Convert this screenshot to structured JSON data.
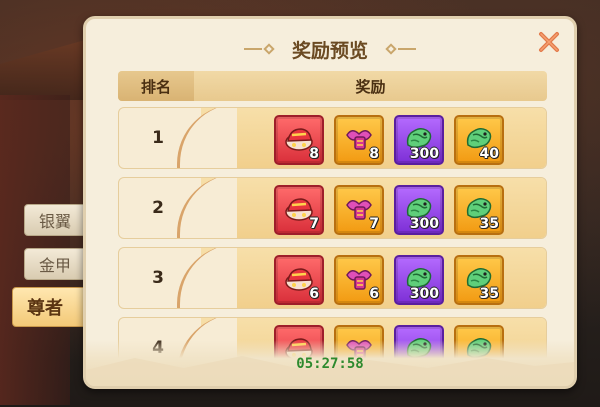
{
  "panel": {
    "title": "奖励预览",
    "header": {
      "rank_label": "排名",
      "reward_label": "奖励"
    },
    "timer": "05:27:58"
  },
  "side_tabs": [
    {
      "label": "银翼",
      "active": false
    },
    {
      "label": "金甲",
      "active": false
    },
    {
      "label": "尊者",
      "active": true
    }
  ],
  "rows": [
    {
      "rank": "1",
      "rewards": [
        {
          "icon": "red-helmet-icon",
          "rarity": "red",
          "qty": "8"
        },
        {
          "icon": "pink-ribbon-icon",
          "rarity": "orange",
          "qty": "8"
        },
        {
          "icon": "jade-dragon-icon",
          "rarity": "purple",
          "qty": "300"
        },
        {
          "icon": "jade-dragon-icon",
          "rarity": "orange",
          "qty": "40"
        }
      ]
    },
    {
      "rank": "2",
      "rewards": [
        {
          "icon": "red-helmet-icon",
          "rarity": "red",
          "qty": "7"
        },
        {
          "icon": "pink-ribbon-icon",
          "rarity": "orange",
          "qty": "7"
        },
        {
          "icon": "jade-dragon-icon",
          "rarity": "purple",
          "qty": "300"
        },
        {
          "icon": "jade-dragon-icon",
          "rarity": "orange",
          "qty": "35"
        }
      ]
    },
    {
      "rank": "3",
      "rewards": [
        {
          "icon": "red-helmet-icon",
          "rarity": "red",
          "qty": "6"
        },
        {
          "icon": "pink-ribbon-icon",
          "rarity": "orange",
          "qty": "6"
        },
        {
          "icon": "jade-dragon-icon",
          "rarity": "purple",
          "qty": "300"
        },
        {
          "icon": "jade-dragon-icon",
          "rarity": "orange",
          "qty": "35"
        }
      ]
    },
    {
      "rank": "4",
      "rewards": [
        {
          "icon": "red-helmet-icon",
          "rarity": "red",
          "qty": ""
        },
        {
          "icon": "pink-ribbon-icon",
          "rarity": "orange",
          "qty": ""
        },
        {
          "icon": "jade-dragon-icon",
          "rarity": "purple",
          "qty": ""
        },
        {
          "icon": "jade-dragon-icon",
          "rarity": "orange",
          "qty": ""
        }
      ]
    }
  ],
  "colors": {
    "panel_bg": "#f6eedc",
    "title": "#6b4a22",
    "timer": "#2e8a2e",
    "rarity_red": "#d92f3a",
    "rarity_orange": "#f29a12",
    "rarity_purple": "#7d2fd6"
  }
}
